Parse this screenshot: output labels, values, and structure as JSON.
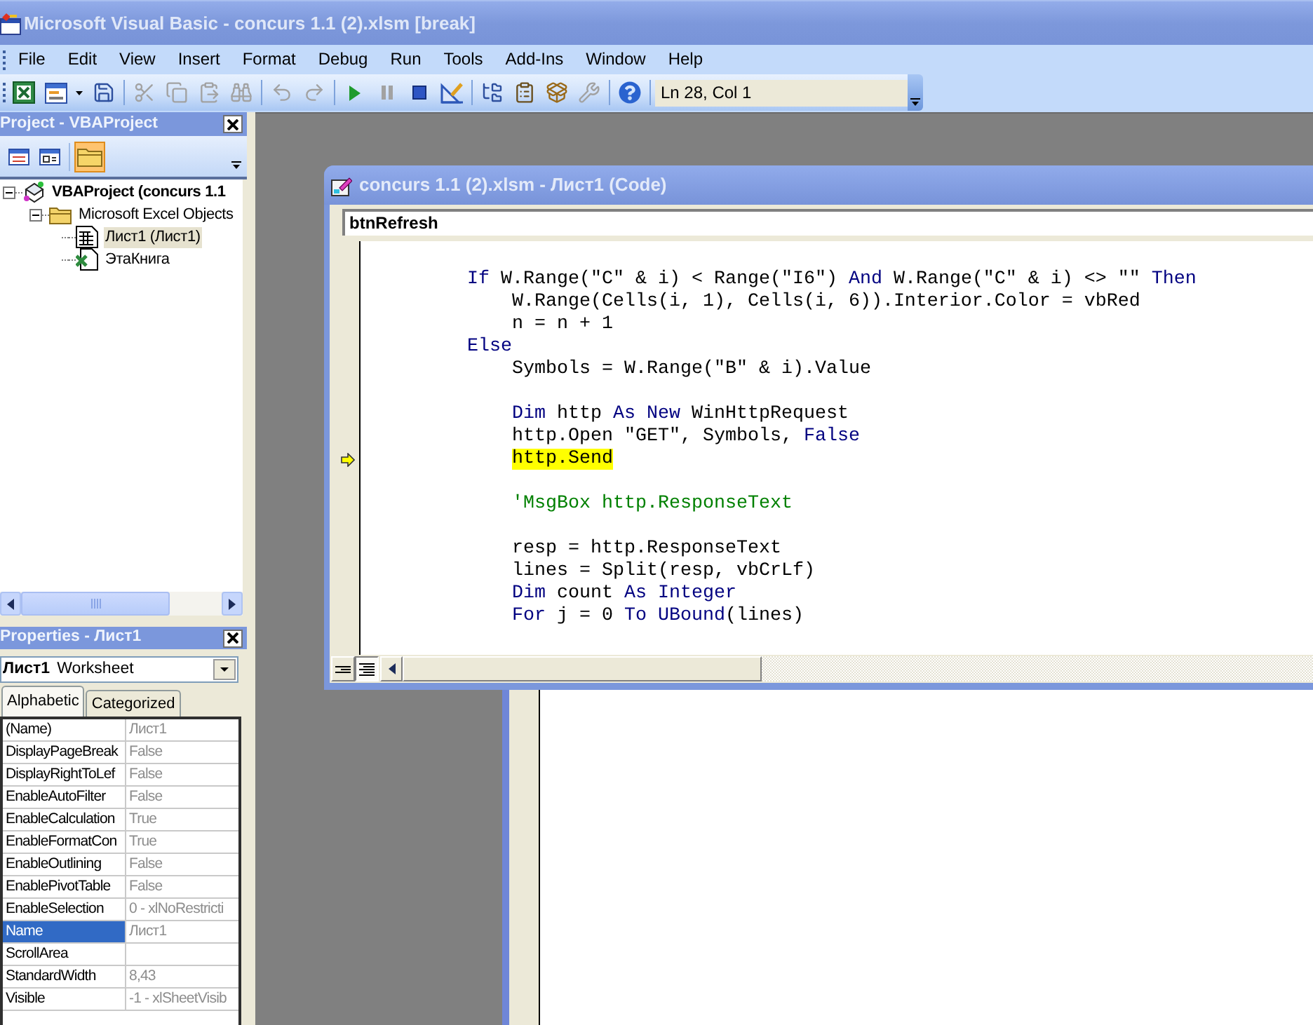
{
  "window": {
    "title": "Microsoft Visual Basic - concurs 1.1 (2).xlsm [break]"
  },
  "menu": [
    "File",
    "Edit",
    "View",
    "Insert",
    "Format",
    "Debug",
    "Run",
    "Tools",
    "Add-Ins",
    "Window",
    "Help"
  ],
  "toolbar": {
    "buttons": [
      {
        "disabled": false
      },
      {
        "disabled": false
      },
      {
        "disabled": false
      },
      {
        "disabled": true
      },
      {
        "disabled": true
      },
      {
        "disabled": true
      },
      {
        "disabled": true
      },
      {
        "disabled": true
      },
      {
        "disabled": true
      },
      {
        "disabled": false
      },
      {
        "disabled": true
      },
      {
        "disabled": false
      },
      {
        "disabled": false
      },
      {
        "disabled": false
      },
      {
        "disabled": false
      },
      {
        "disabled": false
      },
      {
        "disabled": true
      },
      {
        "disabled": false
      }
    ],
    "position": "Ln 28, Col 1"
  },
  "project_panel": {
    "title": "Project - VBAProject",
    "toolbar": [
      {
        "on": false
      },
      {
        "on": false
      },
      {
        "on": true
      }
    ],
    "tree": [
      {
        "kind": "project",
        "label": "VBAProject (concurs 1.1",
        "expanded": true,
        "selected": false,
        "children": [
          {
            "kind": "folder",
            "label": "Microsoft Excel Objects",
            "expanded": true,
            "selected": false,
            "children": [
              {
                "kind": "sheet",
                "label": "Лист1 (Лист1)",
                "selected": true
              },
              {
                "kind": "workbook",
                "label": "ЭтаКнига",
                "selected": false
              }
            ]
          }
        ]
      }
    ]
  },
  "properties_panel": {
    "title": "Properties - Лист1",
    "object": {
      "name": "Лист1",
      "type": "Worksheet"
    },
    "tabs": [
      {
        "label": "Alphabetic",
        "selected": true
      },
      {
        "label": "Categorized",
        "selected": false
      }
    ],
    "rows": [
      {
        "name": "(Name)",
        "value": "Лист1",
        "selected": false
      },
      {
        "name": "DisplayPageBreak",
        "value": "False",
        "selected": false
      },
      {
        "name": "DisplayRightToLef",
        "value": "False",
        "selected": false
      },
      {
        "name": "EnableAutoFilter",
        "value": "False",
        "selected": false
      },
      {
        "name": "EnableCalculation",
        "value": "True",
        "selected": false
      },
      {
        "name": "EnableFormatCon",
        "value": "True",
        "selected": false
      },
      {
        "name": "EnableOutlining",
        "value": "False",
        "selected": false
      },
      {
        "name": "EnablePivotTable",
        "value": "False",
        "selected": false
      },
      {
        "name": "EnableSelection",
        "value": "0 - xlNoRestricti",
        "selected": false
      },
      {
        "name": "Name",
        "value": "Лист1",
        "selected": true
      },
      {
        "name": "ScrollArea",
        "selected": false
      },
      {
        "name": "StandardWidth",
        "value": "8,43",
        "selected": false
      },
      {
        "name": "Visible",
        "value": "-1 - xlSheetVisib",
        "selected": false
      }
    ]
  },
  "code_window": {
    "title": "concurs 1.1 (2).xlsm - Лист1 (Code)",
    "object": "btnRefresh",
    "lines": [
      {
        "kind": "code",
        "current": false,
        "segments": [
          {
            "kind": "keyword",
            "text": "If"
          },
          {
            "kind": "plain",
            "text": " W.Range(\"C\" & i) < Range(\"I6\") "
          },
          {
            "kind": "keyword",
            "text": "And"
          },
          {
            "kind": "plain",
            "text": " W.Range(\"C\" & i) <> \"\" "
          },
          {
            "kind": "keyword",
            "text": "Then"
          }
        ],
        "children": [
          {
            "kind": "code",
            "current": false,
            "segments": [
              {
                "kind": "plain",
                "text": "W.Range(Cells(i, 1), Cells(i, 6)).Interior.Color = vbRed"
              }
            ]
          },
          {
            "kind": "code",
            "current": false,
            "segments": [
              {
                "kind": "plain",
                "text": "n = n + 1"
              }
            ]
          }
        ]
      },
      {
        "kind": "code",
        "current": false,
        "segments": [
          {
            "kind": "keyword",
            "text": "Else"
          }
        ],
        "children": [
          {
            "kind": "code",
            "current": false,
            "segments": [
              {
                "kind": "plain",
                "text": "Symbols = W.Range(\"B\" & i).Value"
              }
            ]
          },
          {
            "kind": "blank"
          },
          {
            "kind": "code",
            "current": false,
            "segments": [
              {
                "kind": "keyword",
                "text": "Dim"
              },
              {
                "kind": "plain",
                "text": " http "
              },
              {
                "kind": "keyword",
                "text": "As New"
              },
              {
                "kind": "plain",
                "text": " WinHttpRequest"
              }
            ]
          },
          {
            "kind": "code",
            "current": false,
            "segments": [
              {
                "kind": "plain",
                "text": "http.Open \"GET\", Symbols, "
              },
              {
                "kind": "keyword",
                "text": "False"
              }
            ]
          },
          {
            "kind": "code",
            "current": true,
            "segments": [
              {
                "kind": "plain",
                "text": "http.Send"
              }
            ]
          },
          {
            "kind": "blank"
          },
          {
            "kind": "code",
            "current": false,
            "segments": [
              {
                "kind": "comment",
                "text": "'MsgBox http.ResponseText"
              }
            ]
          },
          {
            "kind": "blank"
          },
          {
            "kind": "code",
            "current": false,
            "segments": [
              {
                "kind": "plain",
                "text": "resp = http.ResponseText"
              }
            ]
          },
          {
            "kind": "code",
            "current": false,
            "segments": [
              {
                "kind": "plain",
                "text": "lines = Split(resp, vbCrLf)"
              }
            ]
          },
          {
            "kind": "code",
            "current": false,
            "segments": [
              {
                "kind": "keyword",
                "text": "Dim"
              },
              {
                "kind": "plain",
                "text": " count "
              },
              {
                "kind": "keyword",
                "text": "As Integer"
              }
            ]
          },
          {
            "kind": "code",
            "current": false,
            "segments": [
              {
                "kind": "keyword",
                "text": "For"
              },
              {
                "kind": "plain",
                "text": " j = 0 "
              },
              {
                "kind": "keyword",
                "text": "To UBound"
              },
              {
                "kind": "plain",
                "text": "(lines)"
              }
            ]
          }
        ]
      }
    ],
    "view_buttons": [
      {
        "selected": false
      },
      {
        "selected": true
      }
    ]
  }
}
